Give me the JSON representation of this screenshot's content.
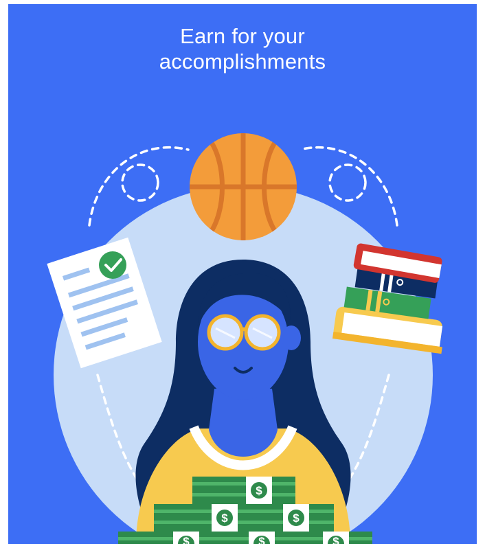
{
  "hero": {
    "title_line_1": "Earn for your",
    "title_line_2": "accomplishments"
  },
  "money": {
    "symbol": "$"
  },
  "colors": {
    "background": "#3d6ef5",
    "circle": "#c7dcf8",
    "skin": "#3a65e6",
    "hair": "#0d2d63",
    "shirt": "#f7ca4f",
    "basketball": "#f39c3a",
    "money_green": "#2e8a4b",
    "check_green": "#35a058"
  }
}
